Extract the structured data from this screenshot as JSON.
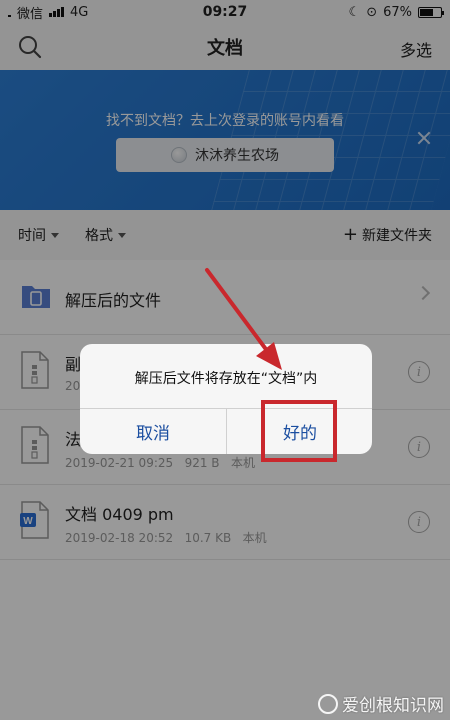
{
  "status_bar": {
    "carrier": "微信",
    "network": "4G",
    "time": "09:27",
    "battery": "67%",
    "battery_level": 0.67
  },
  "nav": {
    "title": "文档",
    "multi_select": "多选",
    "search_icon": "search-icon"
  },
  "banner": {
    "message": "找不到文档？去上次登录的账号内看看",
    "account_name": "沐沐养生农场",
    "close_icon": "close-icon"
  },
  "filters": {
    "time": "时间",
    "format": "格式",
    "new_folder": "新建文件夹"
  },
  "files": [
    {
      "name": "解压后的文件",
      "meta": "",
      "type": "folder"
    },
    {
      "name": "副",
      "meta": "201",
      "type": "archive"
    },
    {
      "name": "法",
      "meta": "2019-02-21 09:25   921 B   本机",
      "type": "archive"
    },
    {
      "name": "文档 0409 pm",
      "meta": "2019-02-18 20:52   10.7 KB   本机",
      "type": "word"
    }
  ],
  "dialog": {
    "message": "解压后文件将存放在“文档”内",
    "cancel": "取消",
    "ok": "好的"
  },
  "watermark": "爱创根知识网",
  "colors": {
    "banner_blue": "#2d7fd6",
    "folder_blue": "#5b7fd4",
    "dialog_button": "#1b4ea0",
    "annotation_red": "#c9282d"
  }
}
